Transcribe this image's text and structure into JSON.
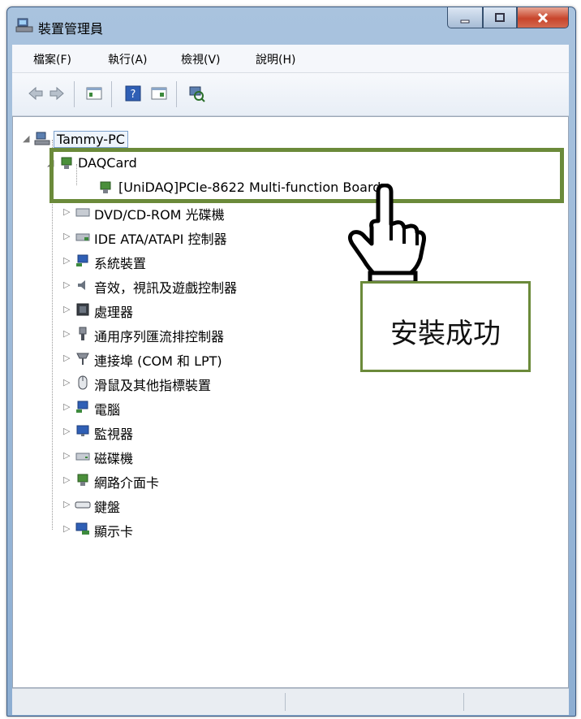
{
  "window": {
    "title": "裝置管理員"
  },
  "menu": [
    "檔案(F)",
    "執行(A)",
    "檢視(V)",
    "說明(H)"
  ],
  "toolbar": [
    "back-icon",
    "forward-icon",
    "properties-icon",
    "help-icon",
    "device-view-icon",
    "scan-hardware-icon"
  ],
  "tree": {
    "root": "Tammy-PC",
    "daq_group": "DAQCard",
    "daq_child": "[UniDAQ]PCIe-8622 Multi-function Board",
    "categories": [
      "DVD/CD-ROM 光碟機",
      "IDE ATA/ATAPI 控制器",
      "系統裝置",
      "音效，視訊及遊戲控制器",
      "處理器",
      "通用序列匯流排控制器",
      "連接埠 (COM 和 LPT)",
      "滑鼠及其他指標裝置",
      "電腦",
      "監視器",
      "磁碟機",
      "網路介面卡",
      "鍵盤",
      "顯示卡"
    ]
  },
  "annotation": {
    "callout_text": "安裝成功"
  },
  "colors": {
    "highlight": "#6b8a3a",
    "titlebar": "#a9c3de",
    "close": "#c8452c"
  }
}
